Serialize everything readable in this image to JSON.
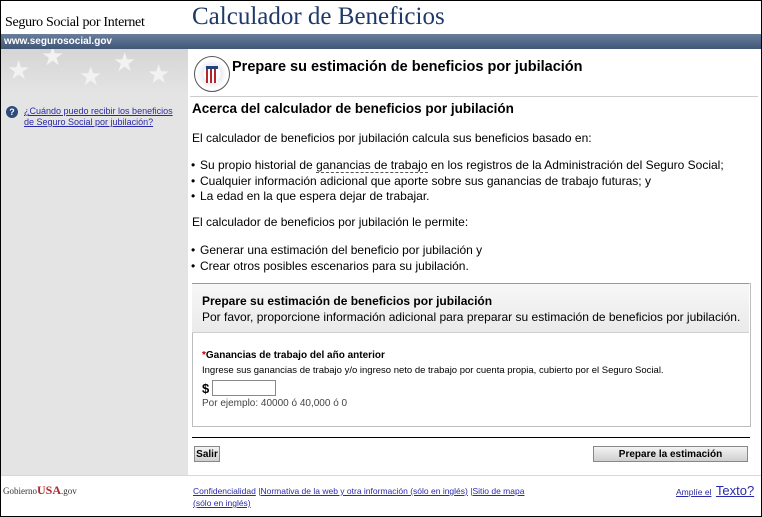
{
  "header": {
    "site_name": "Seguro Social por Internet",
    "app_title": "Calculador de Beneficios",
    "url": "www.segurosocial.gov"
  },
  "sidebar": {
    "help_link": "¿Cuándo puedo recibir los beneficios de Seguro Social por jubilación?",
    "help_icon_glyph": "?"
  },
  "main": {
    "heading": "Prepare su estimación de beneficios por jubilación",
    "section_title": "Acerca del calculador de beneficios por jubilación",
    "intro": "El calculador de beneficios por jubilación calcula sus beneficios basado en:",
    "bullets1": [
      {
        "pre": "Su propio historial de ",
        "term": "ganancias de trabajo",
        "post": " en los registros de la Administración del Seguro Social;"
      },
      {
        "text": "Cualquier información adicional que aporte sobre sus ganancias de trabajo futuras; y"
      },
      {
        "text": "La edad en la que espera dejar de trabajar."
      }
    ],
    "allows": "El calculador de beneficios por jubilación le permite:",
    "bullets2": [
      "Generar una estimación del beneficio por jubilación y",
      "Crear otros posibles escenarios para su jubilación."
    ]
  },
  "form": {
    "title": "Prepare su estimación de beneficios por jubilación",
    "subtitle": "Por favor, proporcione información adicional para preparar su estimación de beneficios por jubilación.",
    "field_required_mark": "*",
    "field_label": "Ganancias de trabajo del año anterior",
    "field_help": "Ingrese sus ganancias de trabajo y/o ingreso neto de trabajo por cuenta propia, cubierto por el Seguro Social.",
    "currency": "$",
    "earnings_value": "",
    "example": "Por ejemplo: 40000 ó 40,000 ó 0"
  },
  "buttons": {
    "exit": "Salir",
    "submit": "Prepare la estimación"
  },
  "footer": {
    "usa_prefix": "Gobierno",
    "usa_brand": "USA",
    "usa_suffix": ".gov",
    "links": [
      "Confidencialidad",
      "Normativa de la web y otra información (sólo en inglés)",
      "Sitio de mapa (sólo en inglés)"
    ],
    "separator": "|",
    "enlarge_prefix": "Amplíe el",
    "enlarge_word": "Texto?"
  },
  "colors": {
    "title_blue": "#1f3a6a",
    "bar": "#3f5677",
    "link": "#2a2aa8",
    "required": "#c00000"
  }
}
